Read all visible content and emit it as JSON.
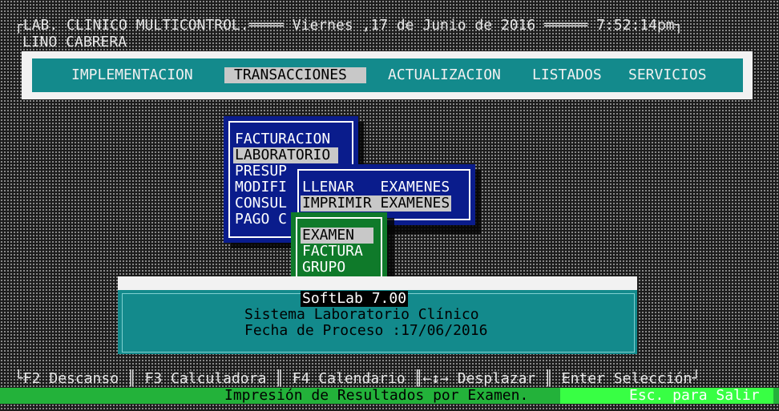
{
  "header": {
    "lab_name": "LAB. CLINICO MULTICONTROL.",
    "date": "Viernes ,17 de Junio de 2016",
    "time": "7:52:14pm",
    "user": "LINO CABRERA"
  },
  "menubar": {
    "items": [
      {
        "label": "IMPLEMENTACION"
      },
      {
        "label": "TRANSACCIONES"
      },
      {
        "label": "ACTUALIZACION"
      },
      {
        "label": "LISTADOS"
      },
      {
        "label": "SERVICIOS"
      }
    ],
    "selected": "TRANSACCIONES"
  },
  "transacciones_menu": {
    "items": [
      {
        "label": "FACTURACION"
      },
      {
        "label": "LABORATORIO"
      },
      {
        "label": "PRESUP"
      },
      {
        "label": "MODIFI"
      },
      {
        "label": "CONSUL"
      },
      {
        "label": "PAGO C"
      }
    ],
    "selected": "LABORATORIO"
  },
  "laboratorio_menu": {
    "items": [
      {
        "label": "LLENAR   EXAMENES"
      },
      {
        "label": "IMPRIMIR EXAMENES"
      }
    ],
    "selected": "IMPRIMIR EXAMENES"
  },
  "imprimir_menu": {
    "items": [
      {
        "label": "EXAMEN"
      },
      {
        "label": "FACTURA"
      },
      {
        "label": "GRUPO"
      }
    ],
    "selected": "EXAMEN"
  },
  "info_panel": {
    "version": "SoftLab 7.00",
    "system": "Sistema Laboratorio Clínico",
    "process_date": "Fecha de Proceso :17/06/2016"
  },
  "footer": {
    "keys": [
      {
        "label": "F2 Descanso"
      },
      {
        "label": "F3 Calculadora"
      },
      {
        "label": "F4 Calendario"
      },
      {
        "label": "←↕→ Desplazar"
      },
      {
        "label": "Enter Selección"
      }
    ],
    "status": "Impresión de Resultados por Examen.",
    "esc_hint": "Esc. para Salir"
  },
  "colors": {
    "menubar": "#138a8c",
    "blue_menu": "#0a1c8c",
    "green_menu": "#0f7a2a",
    "status_bar": "#23b23a",
    "selection": "#c8c8c8"
  }
}
